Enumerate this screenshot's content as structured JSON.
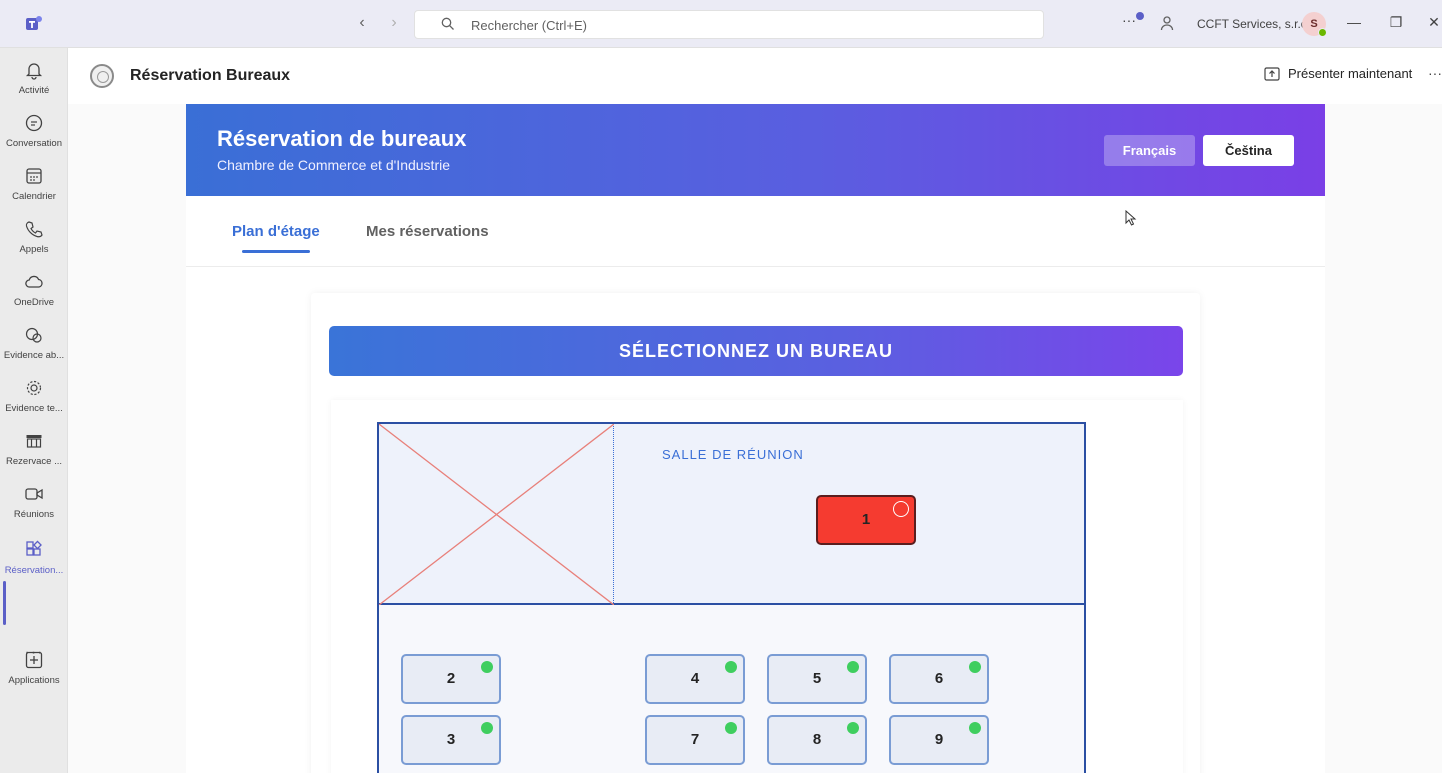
{
  "titlebar": {
    "search_placeholder": "Rechercher (Ctrl+E)",
    "org_name": "CCFT Services, s.r.o.",
    "avatar_initial": "S",
    "more": "···"
  },
  "rail": {
    "items": [
      {
        "label": "Activité",
        "icon": "bell-icon"
      },
      {
        "label": "Conversation",
        "icon": "chat-icon"
      },
      {
        "label": "Calendrier",
        "icon": "calendar-icon"
      },
      {
        "label": "Appels",
        "icon": "phone-icon"
      },
      {
        "label": "OneDrive",
        "icon": "cloud-icon"
      },
      {
        "label": "Evidence ab...",
        "icon": "app-icon"
      },
      {
        "label": "Evidence te...",
        "icon": "gear-icon"
      },
      {
        "label": "Rezervace ...",
        "icon": "table-icon"
      },
      {
        "label": "Réunions",
        "icon": "video-icon"
      },
      {
        "label": "Réservation...",
        "icon": "grid-icon"
      }
    ],
    "more": "···",
    "apps_label": "Applications"
  },
  "app": {
    "title": "Réservation Bureaux",
    "present_label": "Présenter maintenant",
    "more": "···"
  },
  "banner": {
    "title": "Réservation de bureaux",
    "subtitle": "Chambre de Commerce et d'Industrie",
    "lang_fr": "Français",
    "lang_cz": "Čeština"
  },
  "tabs": {
    "floor_plan": "Plan d'étage",
    "my_reservations": "Mes réservations"
  },
  "plan": {
    "header": "SÉLECTIONNEZ UN BUREAU",
    "room_label": "SALLE DE RÉUNION",
    "desks": {
      "d1": "1",
      "d2": "2",
      "d3": "3",
      "d4": "4",
      "d5": "5",
      "d6": "6",
      "d7": "7",
      "d8": "8",
      "d9": "9"
    },
    "status_colors": {
      "available": "#3fce5f",
      "occupied": "#f53b30"
    }
  }
}
